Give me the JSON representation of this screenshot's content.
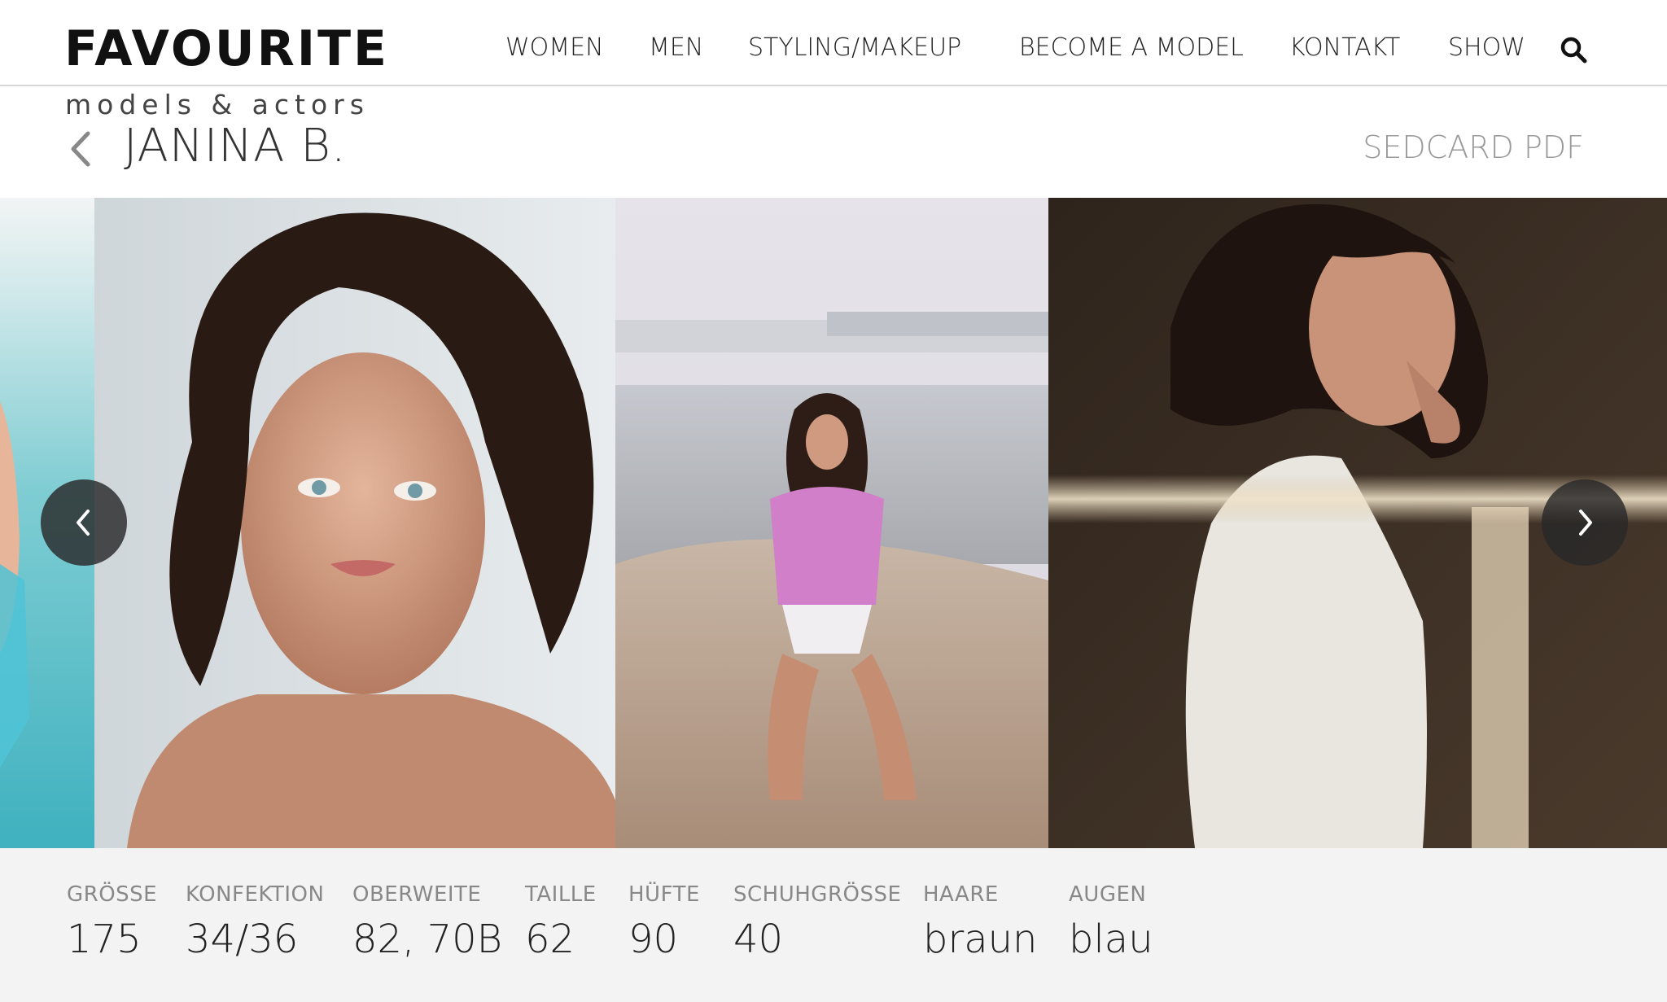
{
  "brand": {
    "name": "FAVOURITE",
    "tagline": "models & actors"
  },
  "nav": {
    "items": [
      {
        "label": "WOMEN"
      },
      {
        "label": "MEN"
      },
      {
        "label": "STYLING/MAKEUP"
      },
      {
        "label": "BECOME A MODEL"
      },
      {
        "label": "KONTAKT"
      },
      {
        "label": "SHOW"
      }
    ],
    "search_icon": "search-icon"
  },
  "profile": {
    "back_icon": "chevron-left-icon",
    "name": "JANINA B.",
    "sedcard_link": "SEDCARD PDF"
  },
  "gallery": {
    "prev_icon": "chevron-left-icon",
    "next_icon": "chevron-right-icon",
    "photos": [
      {
        "subject": "beach-edge-partial"
      },
      {
        "subject": "portrait-close-up"
      },
      {
        "subject": "beach-pink-shirt"
      },
      {
        "subject": "white-tshirt-portrait"
      }
    ]
  },
  "stats": [
    {
      "label": "GRÖSSE",
      "value": "175"
    },
    {
      "label": "KONFEKTION",
      "value": "34/36"
    },
    {
      "label": "OBERWEITE",
      "value": "82, 70B"
    },
    {
      "label": "TAILLE",
      "value": "62"
    },
    {
      "label": "HÜFTE",
      "value": "90"
    },
    {
      "label": "SCHUHGRÖSSE",
      "value": "40"
    },
    {
      "label": "HAARE",
      "value": "braun"
    },
    {
      "label": "AUGEN",
      "value": "blau"
    }
  ],
  "colors": {
    "header_bg": "#ffffff",
    "stats_bg": "#f3f3f3",
    "sedcard_text": "#9a9a9a",
    "arrow_bg": "#2e2e2e"
  }
}
